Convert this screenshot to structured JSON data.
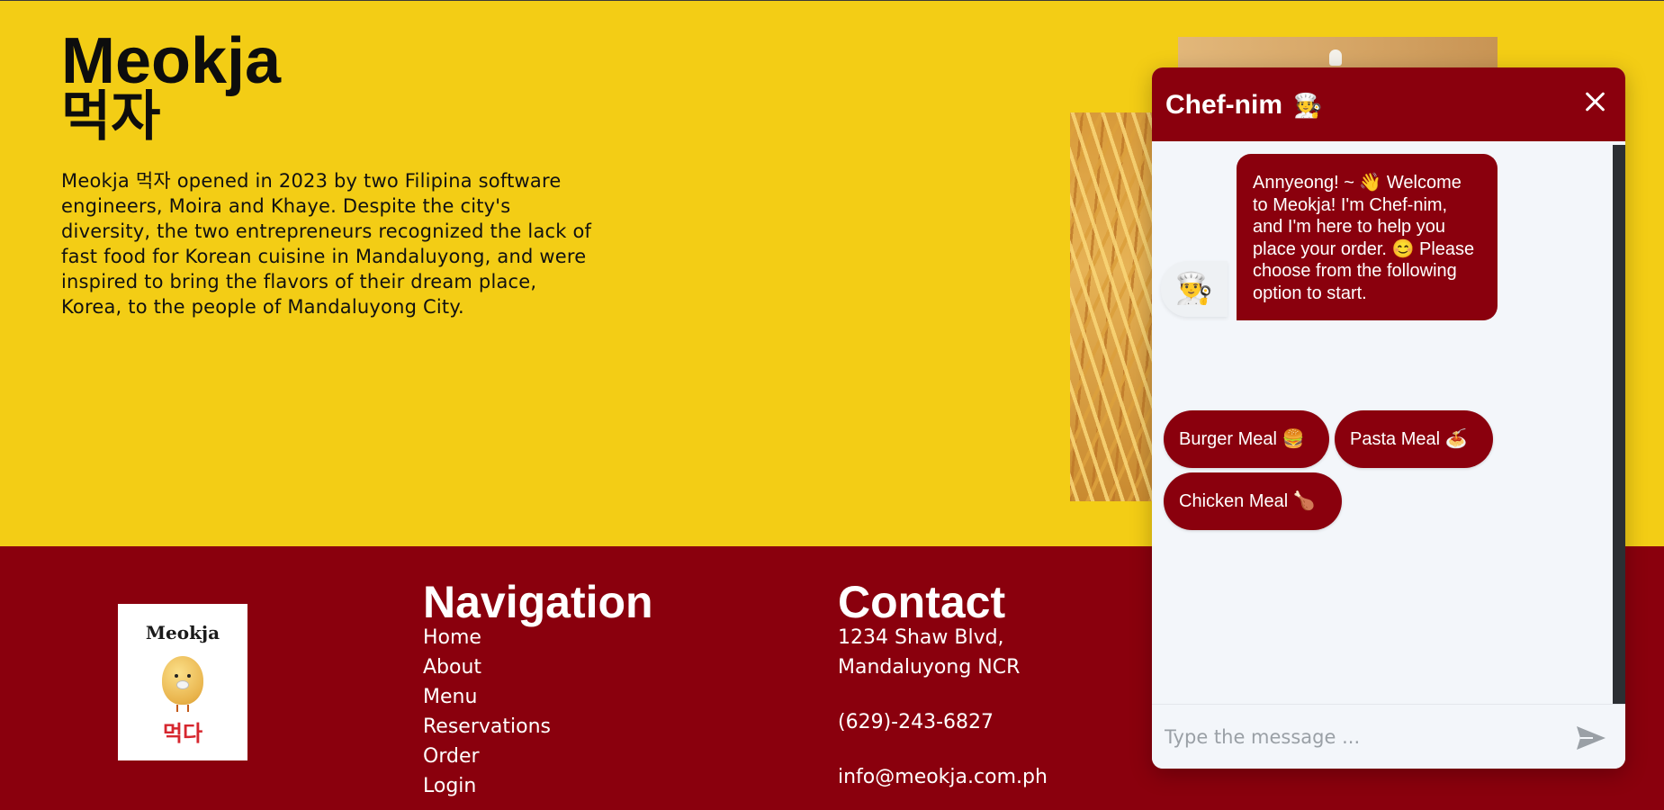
{
  "hero": {
    "title": "Meokja",
    "title_korean": "먹자",
    "about_text": "Meokja 먹자 opened in 2023 by two Filipina software engineers, Moira and Khaye. Despite the city's diversity, the two entrepreneurs recognized the lack of fast food for Korean cuisine in Mandaluyong, and were inspired to bring the flavors of their dream place, Korea, to the people of Mandaluyong City."
  },
  "footer": {
    "logo": {
      "name": "Meokja",
      "korean": "먹다"
    },
    "navigation": {
      "title": "Navigation",
      "items": [
        "Home",
        "About",
        "Menu",
        "Reservations",
        "Order",
        "Login"
      ]
    },
    "contact": {
      "title": "Contact",
      "address_line1": "1234 Shaw Blvd,",
      "address_line2": "Mandaluyong NCR",
      "phone": "(629)-243-6827",
      "email": "info@meokja.com.ph"
    }
  },
  "chat": {
    "title": "Chef-nim",
    "title_emoji": "🧑‍🍳",
    "avatar_emoji": "👨‍🍳",
    "bot_message": "Annyeong! ~ 👋 Welcome to Meokja! I'm Chef-nim, and I'm here to help you place your order. 😊 Please choose from the following option to start.",
    "options": [
      "Burger Meal 🍔",
      "Pasta Meal 🍝",
      "Chicken Meal 🍗"
    ],
    "input_placeholder": "Type the message ...",
    "icons": {
      "close": "close-icon",
      "send": "send-icon"
    }
  },
  "colors": {
    "hero_background": "#f3cd15",
    "brand_red": "#8a000d",
    "chat_background": "#f3f6fa"
  }
}
